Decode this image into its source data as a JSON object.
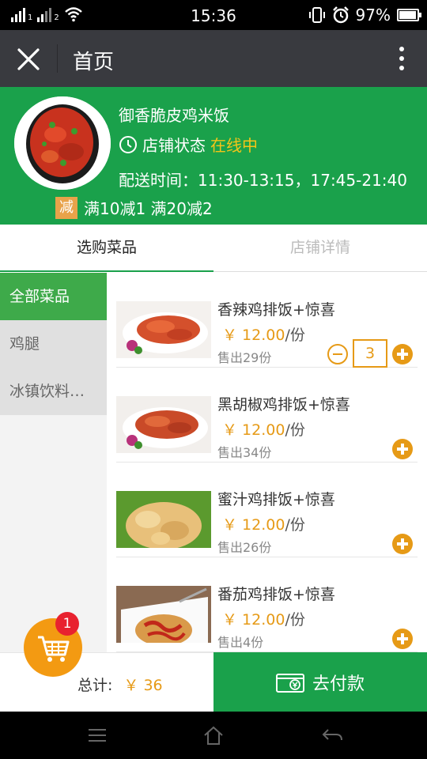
{
  "status_bar": {
    "time": "15:36",
    "battery": "97%",
    "battery_level": 0.97,
    "sim1": "1",
    "sim2": "2",
    "icons": [
      "signal-icon",
      "wifi-icon",
      "vibrate-icon",
      "alarm-icon",
      "battery-icon"
    ]
  },
  "title_bar": {
    "title": "首页",
    "icons": [
      "close-icon",
      "more-icon"
    ]
  },
  "shop": {
    "name": "御香脆皮鸡米饭",
    "status_label": "店铺状态",
    "status_value": "在线中",
    "delivery_label": "配送时间：",
    "delivery_times": "11:30-13:15，17:45-21:40",
    "promo_badge": "减",
    "promo_text": "满10减1 满20减2"
  },
  "tabs": [
    {
      "label": "选购菜品",
      "active": true
    },
    {
      "label": "店铺详情",
      "active": false
    }
  ],
  "categories": [
    {
      "label": "全部菜品",
      "active": true
    },
    {
      "label": "鸡腿",
      "active": false
    },
    {
      "label": "冰镇饮料…",
      "active": false
    }
  ],
  "items": [
    {
      "name": "香辣鸡排饭+惊喜",
      "price": "￥ 12.00",
      "unit": "/份",
      "sold": "售出29份",
      "qty": "3"
    },
    {
      "name": "黑胡椒鸡排饭+惊喜",
      "price": "￥ 12.00",
      "unit": "/份",
      "sold": "售出34份"
    },
    {
      "name": "蜜汁鸡排饭+惊喜",
      "price": "￥ 12.00",
      "unit": "/份",
      "sold": "售出26份"
    },
    {
      "name": "番茄鸡排饭+惊喜",
      "price": "￥ 12.00",
      "unit": "/份",
      "sold": "售出4份"
    }
  ],
  "cart": {
    "count": "1",
    "total_label": "总计:",
    "total_amount": "￥ 36",
    "pay_label": "去付款"
  },
  "colors": {
    "green": "#1aa14b",
    "orange": "#e69a16",
    "titlebar": "#393a3f"
  }
}
